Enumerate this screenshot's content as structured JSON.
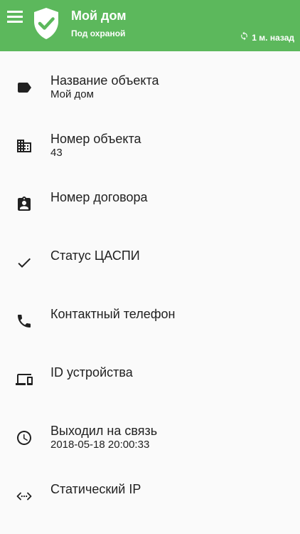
{
  "header": {
    "title": "Мой дом",
    "subtitle": "Под охраной",
    "sync_text": "1 м. назад",
    "background_color": "#5cb85c",
    "icons": {
      "menu": "menu-icon",
      "status": "shield-check-icon",
      "sync": "sync-icon"
    }
  },
  "items": [
    {
      "label": "Название объекта",
      "value": "Мой дом",
      "icon": "label-tag-icon"
    },
    {
      "label": "Номер объекта",
      "value": "43",
      "icon": "building-icon"
    },
    {
      "label": "Номер договора",
      "value": "",
      "icon": "contract-badge-icon"
    },
    {
      "label": "Статус ЦАСПИ",
      "value": "",
      "icon": "check-icon"
    },
    {
      "label": "Контактный телефон",
      "value": "",
      "icon": "phone-icon"
    },
    {
      "label": "ID устройства",
      "value": "",
      "icon": "devices-icon"
    },
    {
      "label": "Выходил на связь",
      "value": "2018-05-18 20:00:33",
      "icon": "clock-icon"
    },
    {
      "label": "Статический IP",
      "value": "",
      "icon": "code-arrows-icon"
    }
  ]
}
